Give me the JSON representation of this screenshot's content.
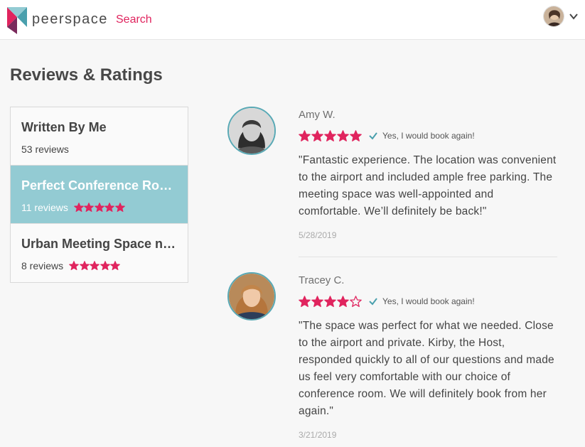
{
  "header": {
    "brand": "peerspace",
    "search_link": "Search",
    "logo_colors": [
      "#e0245e",
      "#4aa0ad",
      "#7a2a5c"
    ]
  },
  "page": {
    "title": "Reviews & Ratings"
  },
  "sidebar": {
    "items": [
      {
        "title": "Written By Me",
        "count": "53 reviews",
        "stars": 0,
        "active": false
      },
      {
        "title": "Perfect Conference Room near Airport",
        "count": "11 reviews",
        "stars": 5,
        "active": true
      },
      {
        "title": "Urban Meeting Space near Downtown",
        "count": "8 reviews",
        "stars": 5,
        "active": false
      }
    ]
  },
  "reviews": [
    {
      "name": "Amy W.",
      "rating": 5,
      "book_again": "Yes, I would book again!",
      "text": "\"Fantastic experience. The location was convenient to the airport and included ample free parking. The meeting space was well-appointed and comfortable. We’ll definitely be back!\"",
      "date": "5/28/2019"
    },
    {
      "name": "Tracey C.",
      "rating": 4,
      "book_again": "Yes, I would book again!",
      "text": "\"The space was perfect for what we needed. Close to the airport and private. Kirby, the Host, responded quickly to all of our questions and made us feel very comfortable with our choice of conference room. We will definitely book from her again.\"",
      "date": "3/21/2019"
    }
  ],
  "colors": {
    "star": "#e0245e",
    "accent": "#93cbd3",
    "avatar_ring": "#59a9b5",
    "check": "#4aa0ad"
  }
}
